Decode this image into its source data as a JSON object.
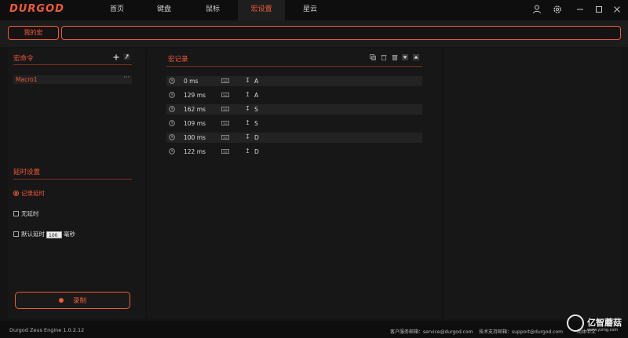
{
  "app": {
    "logo": "DURGOD",
    "nav": [
      "首页",
      "键盘",
      "鼠标",
      "宏设置",
      "星云"
    ],
    "active_nav": "宏设置"
  },
  "subbar": {
    "my_macro_tab": "我的宏",
    "macro_name_value": ""
  },
  "left": {
    "macro_panel_title": "宏命令",
    "macros": [
      {
        "name": "Macro1",
        "more": "···"
      }
    ],
    "delay_title": "延时设置",
    "options": {
      "record_delay": "记录延时",
      "no_delay": "无延时",
      "default_delay": "默认延时",
      "default_delay_value": "100",
      "unit": "毫秒"
    },
    "record_button": "录制"
  },
  "center": {
    "title": "宏记录",
    "events": [
      {
        "delay": "0 ms",
        "dir": "↧",
        "key": "A"
      },
      {
        "delay": "129 ms",
        "dir": "↥",
        "key": "A"
      },
      {
        "delay": "162 ms",
        "dir": "↧",
        "key": "S"
      },
      {
        "delay": "109 ms",
        "dir": "↥",
        "key": "S"
      },
      {
        "delay": "100 ms",
        "dir": "↧",
        "key": "D"
      },
      {
        "delay": "122 ms",
        "dir": "↥",
        "key": "D"
      }
    ]
  },
  "footer": {
    "version": "Durgod Zeus Engine 1.0.2.12",
    "service_label": "客户服务邮箱：service@durgod.com",
    "support_label": "技术支持邮箱：support@durgod.com",
    "language": "简体中文"
  },
  "watermark": {
    "text": "亿智蘑菇",
    "url": "www.yzmg.com"
  },
  "colors": {
    "accent": "#f05a38",
    "bg": "#141414",
    "panel": "#171717"
  }
}
